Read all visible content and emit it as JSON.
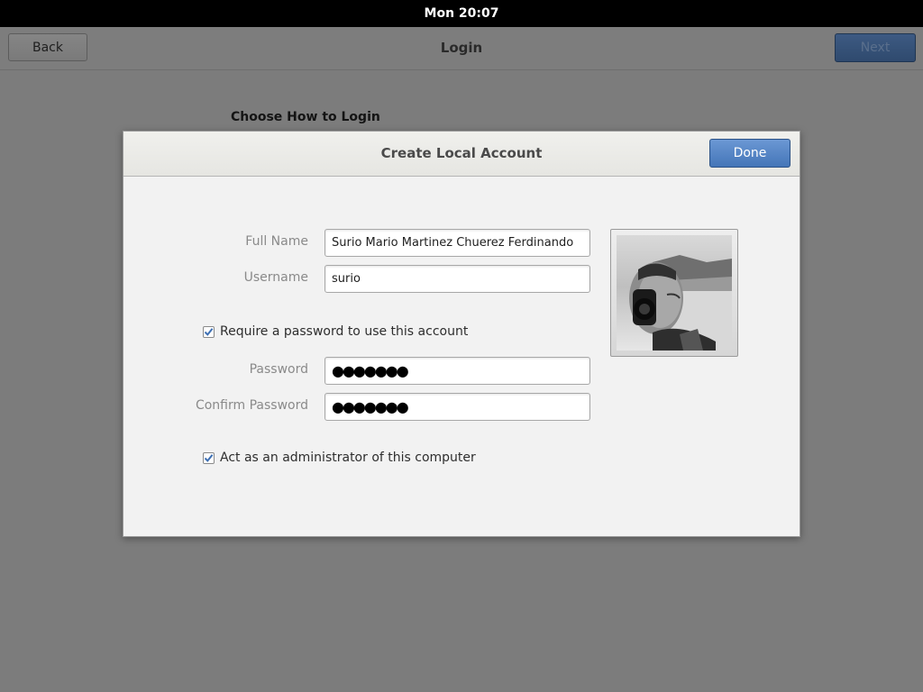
{
  "system_bar": {
    "clock": "Mon 20:07"
  },
  "header": {
    "title": "Login",
    "back_label": "Back",
    "next_label": "Next"
  },
  "page": {
    "section_heading": "Choose How to Login"
  },
  "dialog": {
    "title": "Create Local Account",
    "done_label": "Done",
    "full_name": {
      "label": "Full Name",
      "value": "Surio Mario Martinez Chuerez Ferdinando"
    },
    "username": {
      "label": "Username",
      "value": "surio"
    },
    "require_password": {
      "label": "Require a password to use this account",
      "checked": true
    },
    "password": {
      "label": "Password",
      "value": "●●●●●●●"
    },
    "confirm_password": {
      "label": "Confirm Password",
      "value": "●●●●●●●"
    },
    "admin": {
      "label": "Act as an administrator of this computer",
      "checked": true
    },
    "avatar_icon": "user-avatar-photo"
  },
  "colors": {
    "accent": "#4a7bbf",
    "overlay": "#7c7c7c",
    "dialog_bg": "#f2f2f2"
  }
}
